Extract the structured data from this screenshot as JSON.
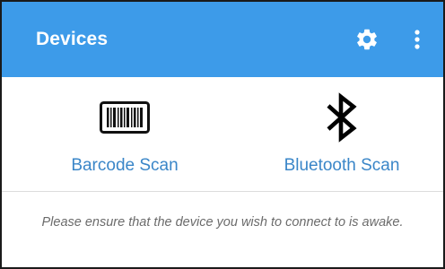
{
  "app_bar": {
    "title": "Devices",
    "background_color": "#3d9be9",
    "actions": [
      {
        "icon": "gear-icon",
        "label": "Settings"
      },
      {
        "icon": "more-vert-icon",
        "label": "More options"
      }
    ]
  },
  "scan_options": [
    {
      "icon": "barcode-icon",
      "label": "Barcode Scan"
    },
    {
      "icon": "bluetooth-icon",
      "label": "Bluetooth Scan"
    }
  ],
  "notice": {
    "text": "Please ensure that the device you wish to connect to is awake."
  },
  "colors": {
    "accent": "#3d9be9",
    "link_text": "#3a86c8",
    "hint_text": "#6b6b6b"
  }
}
